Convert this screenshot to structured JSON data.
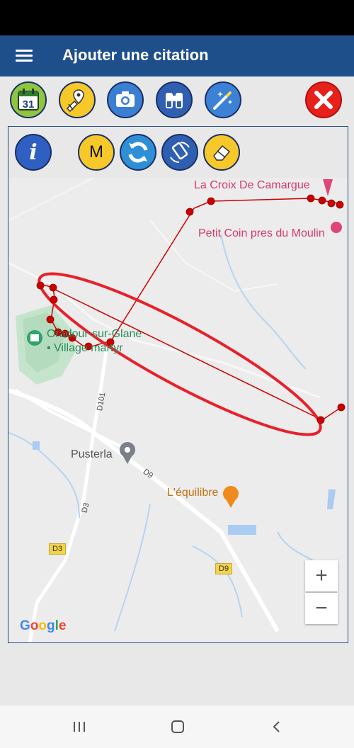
{
  "header": {
    "title": "Ajouter une citation"
  },
  "toolbar": {
    "calendar_day": "31",
    "buttons": [
      "calendar-icon",
      "location-edit-icon",
      "camera-icon",
      "binoculars-icon",
      "magic-wand-icon",
      "close-icon"
    ]
  },
  "map_tools": {
    "info_label": "i",
    "m_label": "M",
    "buttons": [
      "info-icon",
      "m-icon",
      "refresh-icon",
      "rotate-icon",
      "eraser-icon"
    ]
  },
  "map": {
    "labels": {
      "poi1": "La Croix De Camargue",
      "poi2": "Petit Coin pres du Moulin",
      "village_line1": "Oradour-sur-Glane",
      "village_line2": "• Village martyr",
      "place": "Pusterla",
      "restaurant": "L'équilibre"
    },
    "roads": {
      "d101": "D101",
      "d9_label": "D9",
      "d3_label": "D3",
      "d3_shield": "D3",
      "d9_shield": "D9"
    },
    "zoom_in": "+",
    "zoom_out": "−",
    "attribution": "Google",
    "colors": {
      "track": "#cc0000",
      "ellipse": "#e8202a",
      "marker": "#cc0000"
    }
  },
  "navbar": {
    "icons": [
      "recents-icon",
      "home-icon",
      "back-icon"
    ]
  }
}
